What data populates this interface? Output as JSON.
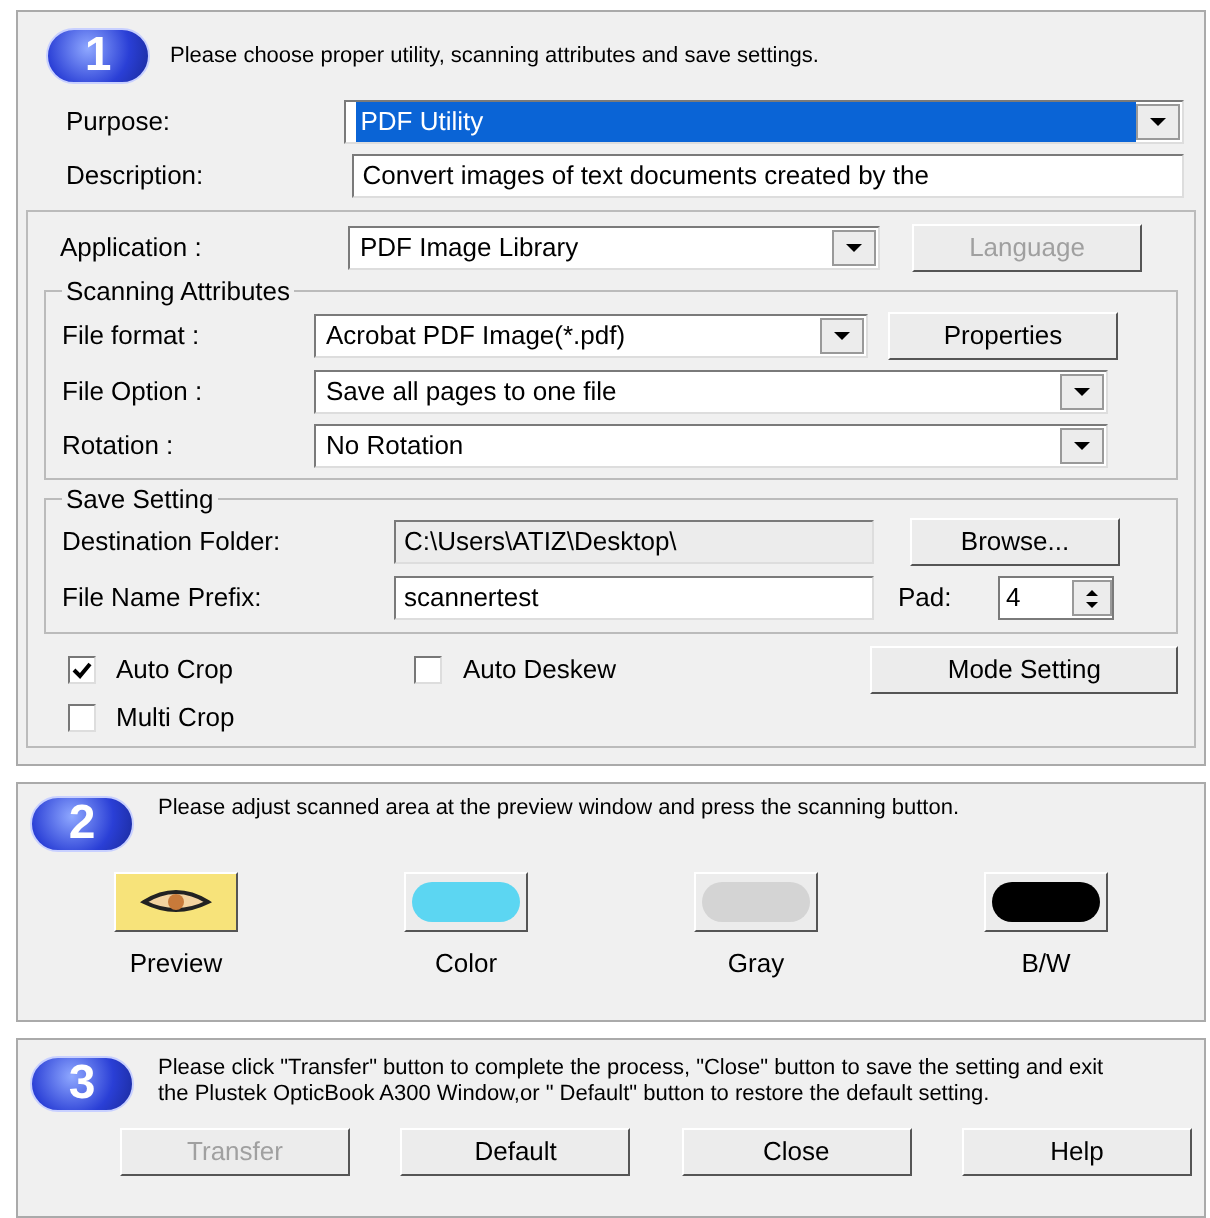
{
  "step1": {
    "number": "1",
    "instruction": "Please choose proper utility, scanning attributes and save settings.",
    "purpose": {
      "label": "Purpose:",
      "value": "PDF Utility",
      "highlighted": true
    },
    "description": {
      "label": "Description:",
      "value": "Convert images of text documents created by the"
    },
    "application": {
      "label": "Application :",
      "value": "PDF Image Library"
    },
    "language_button": {
      "label": "Language",
      "disabled": true
    },
    "scanning_attributes": {
      "title": "Scanning Attributes",
      "rows": [
        {
          "label": "File format :",
          "value": "Acrobat PDF Image(*.pdf)",
          "button": "Properties"
        },
        {
          "label": "File Option :",
          "value": "Save all pages to one file"
        },
        {
          "label": "Rotation :",
          "value": "No Rotation"
        }
      ]
    },
    "save_setting": {
      "title": "Save Setting",
      "destination": {
        "label": "Destination Folder:",
        "value": "C:\\Users\\ATIZ\\Desktop\\",
        "readonly": true
      },
      "browse_button": "Browse...",
      "prefix": {
        "label": "File Name Prefix:",
        "value": "scannertest",
        "readonly": false
      },
      "pad": {
        "label": "Pad:",
        "value": "4"
      }
    },
    "checkboxes": [
      {
        "label": "Auto Crop",
        "checked": true
      },
      {
        "label": "Auto Deskew",
        "checked": false
      },
      {
        "label": "Multi Crop",
        "checked": false
      }
    ],
    "mode_button": "Mode Setting"
  },
  "step2": {
    "number": "2",
    "instruction": "Please adjust scanned area at the preview window and press the scanning button.",
    "scan_buttons": [
      {
        "label": "Preview",
        "kind": "preview"
      },
      {
        "label": "Color",
        "kind": "color"
      },
      {
        "label": "Gray",
        "kind": "gray"
      },
      {
        "label": "B/W",
        "kind": "bw"
      }
    ]
  },
  "step3": {
    "number": "3",
    "instruction": "Please click \"Transfer\" button to complete the process, \"Close\" button to save the setting and exit the Plustek OpticBook A300 Window,or \" Default\" button to restore the default setting.",
    "buttons": [
      {
        "label": "Transfer",
        "disabled": true
      },
      {
        "label": "Default",
        "disabled": false
      },
      {
        "label": "Close",
        "disabled": false
      },
      {
        "label": "Help",
        "disabled": false
      }
    ]
  }
}
